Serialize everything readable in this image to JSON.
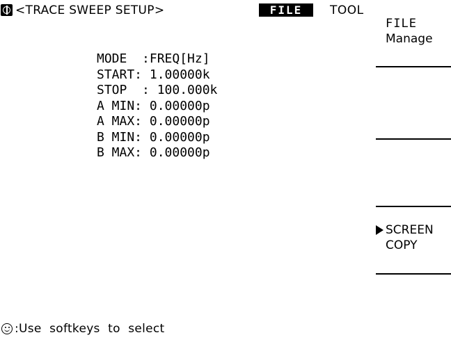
{
  "header": {
    "title": "<TRACE SWEEP SETUP>",
    "tabs": [
      {
        "label": "FILE",
        "selected": true
      },
      {
        "label": "TOOL",
        "selected": false
      }
    ]
  },
  "params": [
    {
      "label": "MODE  :",
      "value": "FREQ[Hz]"
    },
    {
      "label": "START: ",
      "value": "1.00000k"
    },
    {
      "label": "STOP  : ",
      "value": "100.000k"
    },
    {
      "label": "A MIN: ",
      "value": "0.00000p"
    },
    {
      "label": "A MAX: ",
      "value": "0.00000p"
    },
    {
      "label": "B MIN: ",
      "value": "0.00000p"
    },
    {
      "label": "B MAX: ",
      "value": "0.00000p"
    }
  ],
  "softkeys": [
    {
      "line1": "FILE",
      "line2": "Manage"
    },
    {
      "line1": "",
      "line2": ""
    },
    {
      "line1": "",
      "line2": ""
    },
    {
      "line1": "SCREEN",
      "line2": "COPY"
    },
    {
      "line1": "",
      "line2": ""
    }
  ],
  "footer": {
    "hint": ":Use  softkeys  to  select"
  },
  "icons": {
    "menu": "menu-icon",
    "arrow": "arrow-right-icon",
    "status": "smiley-icon"
  }
}
